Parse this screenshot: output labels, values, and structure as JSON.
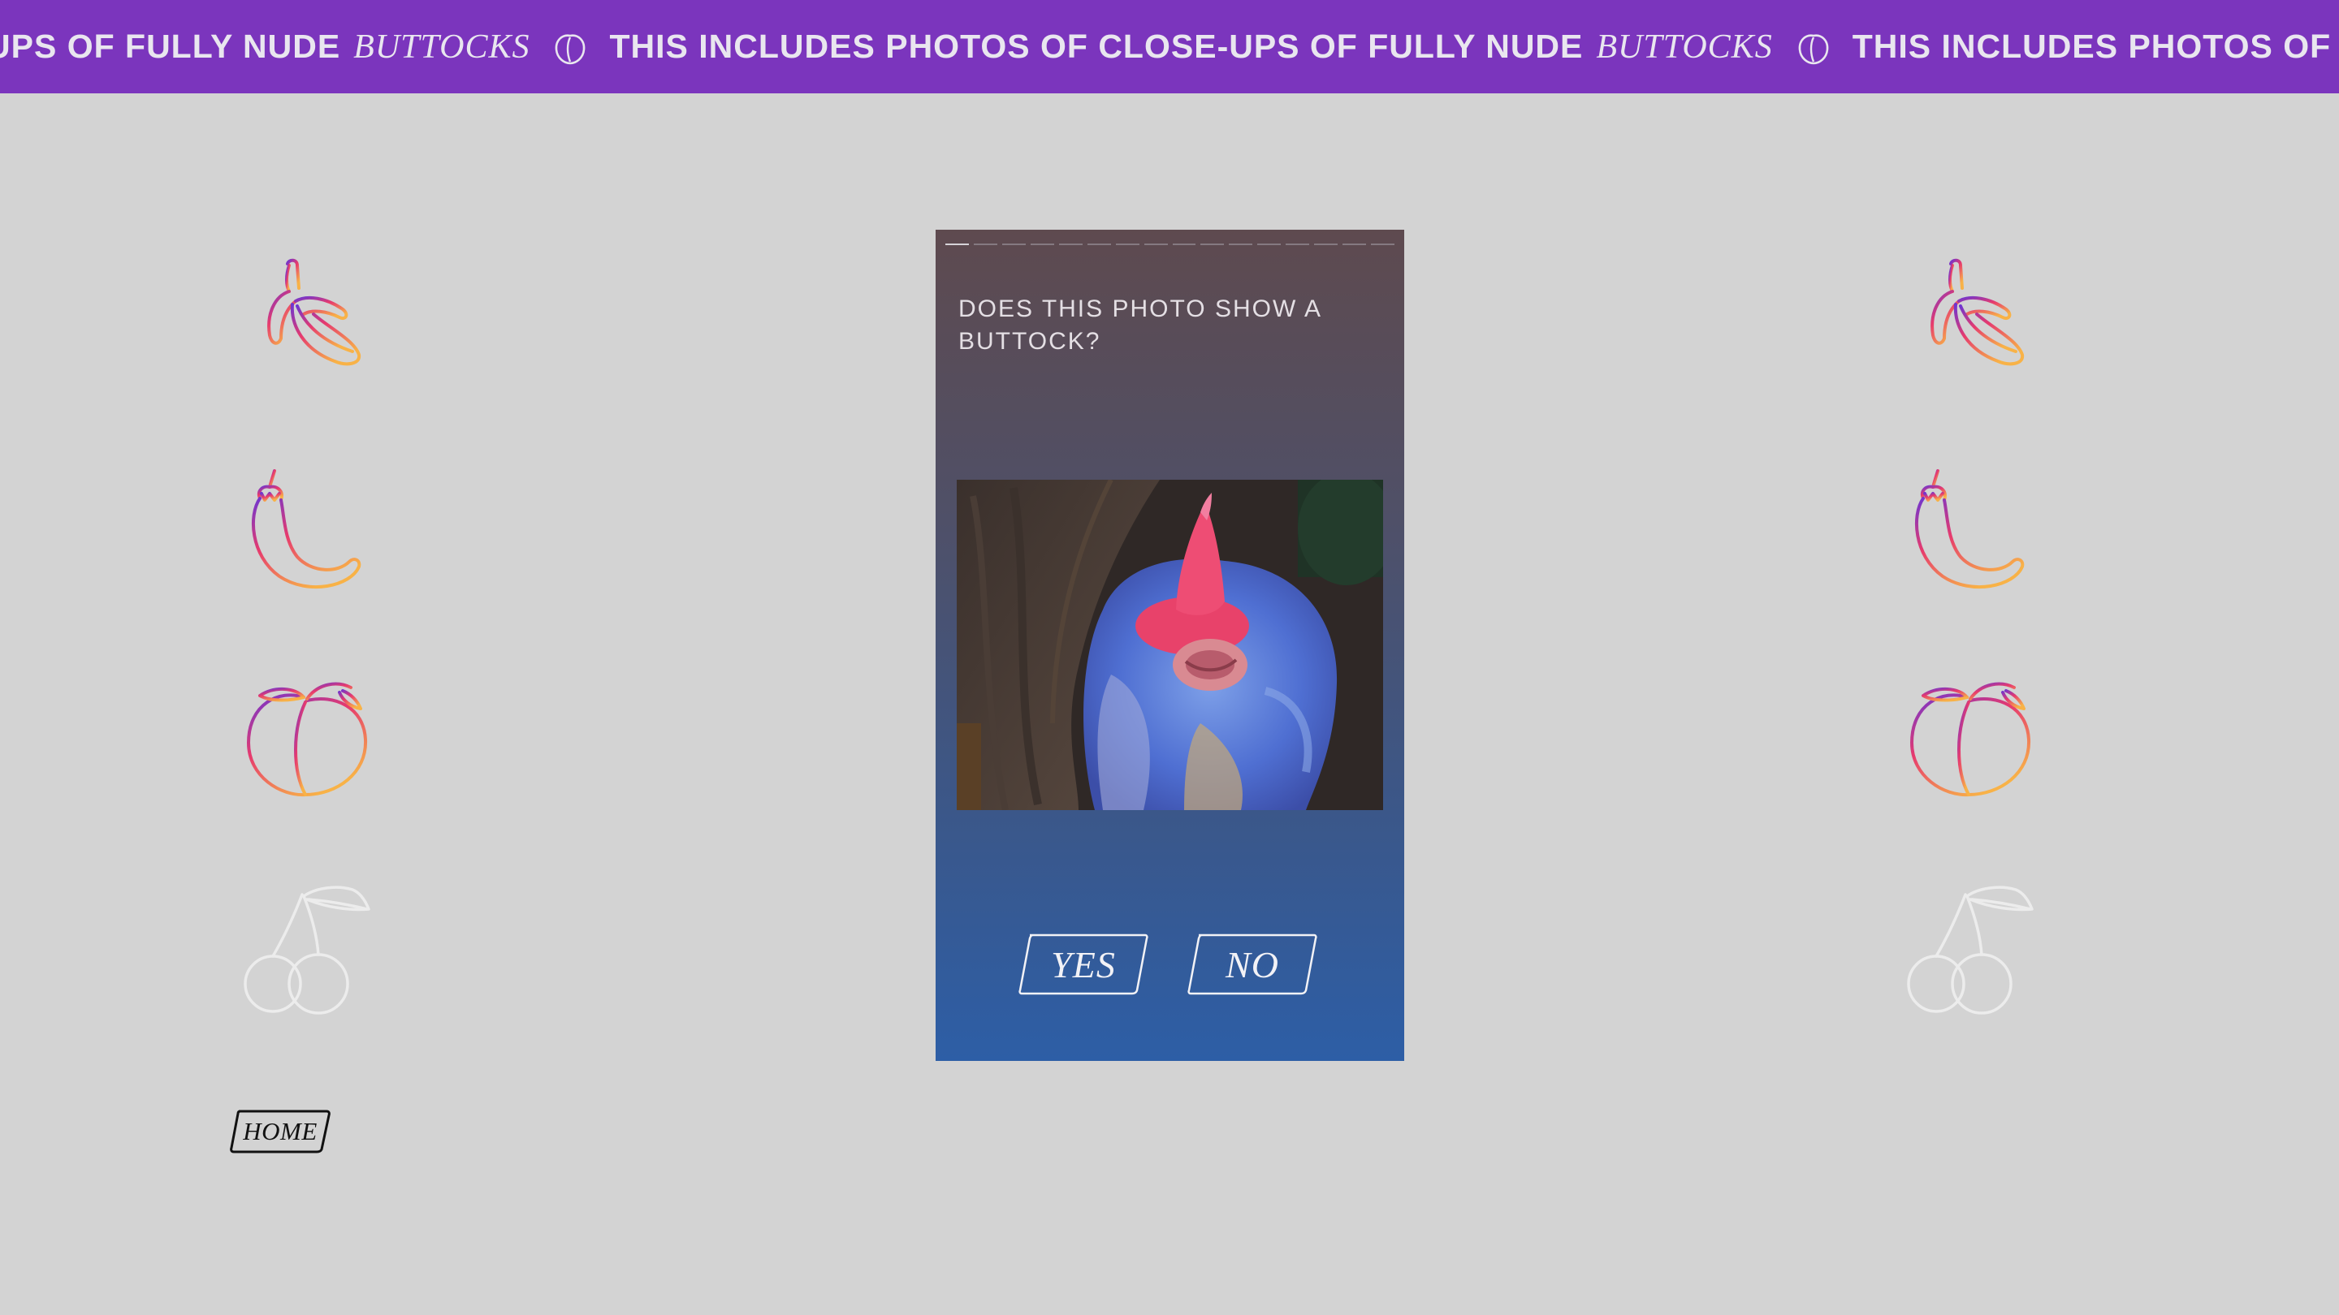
{
  "banner": {
    "segments": [
      {
        "bold": "E-UPS OF FULLY NUDE",
        "italic": "BUTTOCKS"
      },
      {
        "bold": "THIS INCLUDES PHOTOS OF CLOSE-UPS OF FULLY NUDE",
        "italic": "BUTTOCKS"
      },
      {
        "bold": "THIS INCLUDES PHOTOS OF",
        "italic": ""
      }
    ],
    "background": "#7b35bd"
  },
  "fruit_icons": [
    "banana-icon",
    "eggplant-icon",
    "peach-icon",
    "cherry-icon"
  ],
  "card": {
    "question": "DOES THIS PHOTO SHOW A BUTTOCK?",
    "progress_total": 16,
    "progress_current": 1,
    "image_alt": "baboon-buttock-photo"
  },
  "buttons": {
    "yes_label": "YES",
    "no_label": "NO",
    "home_label": "HOME"
  },
  "colors": {
    "page_bg": "#d3d3d3",
    "gradient_purple": "#7a36c9",
    "gradient_pink": "#e8336b",
    "gradient_orange": "#f7a640",
    "cherry_outline": "#ececec"
  }
}
